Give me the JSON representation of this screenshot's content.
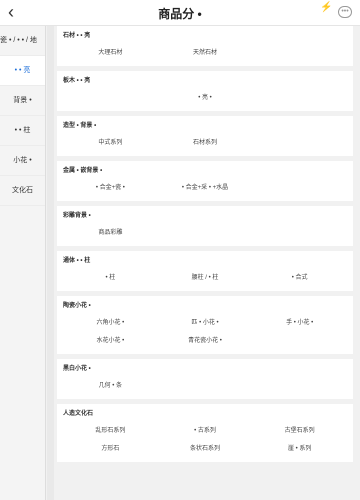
{
  "header": {
    "title": "商品分 •",
    "flash": "⚡",
    "more": "•••"
  },
  "sidebar": {
    "items": [
      {
        "label": "瓷 • / • • / 地",
        "active": false
      },
      {
        "label": "• • 亮",
        "active": true
      },
      {
        "label": "背景 •",
        "active": false
      },
      {
        "label": "• • 柱",
        "active": false
      },
      {
        "label": "小花 •",
        "active": false
      },
      {
        "label": "文化石",
        "active": false
      }
    ]
  },
  "sections": [
    {
      "title": "石材 • • 亮",
      "rows": [
        [
          "大理石材",
          "天然石材",
          ""
        ]
      ]
    },
    {
      "title": "板木 • • 亮",
      "rows": [
        [
          "",
          "• 亮 •",
          ""
        ]
      ]
    },
    {
      "title": "造型 • 背景 •",
      "rows": [
        [
          "中式系列",
          "石材系列",
          ""
        ]
      ]
    },
    {
      "title": "金属 • 嵌背景 •",
      "rows": [
        [
          "• 合金+瓷 •",
          "• 合金+采 • +水晶",
          ""
        ]
      ]
    },
    {
      "title": "彩雕背景 •",
      "rows": [
        [
          "商品彩雕",
          "",
          ""
        ]
      ]
    },
    {
      "title": "通体 • • 柱",
      "rows": [
        [
          "• 柱",
          "腰柱 / • 柱",
          "• 合式"
        ]
      ]
    },
    {
      "title": "陶瓷小花 •",
      "rows": [
        [
          "六角小花 •",
          "匹 • 小花 •",
          "手 • 小花 •"
        ],
        [
          "水花小花 •",
          "青花瓷小花 •",
          ""
        ]
      ]
    },
    {
      "title": "黑白小花 •",
      "rows": [
        [
          "几何 • 条",
          "",
          ""
        ]
      ]
    },
    {
      "title": "人造文化石",
      "rows": [
        [
          "乱形石系列",
          "• 古系列",
          "古堡石系列"
        ],
        [
          "方形石",
          "条状石系列",
          "崖 • 系列"
        ]
      ]
    }
  ]
}
